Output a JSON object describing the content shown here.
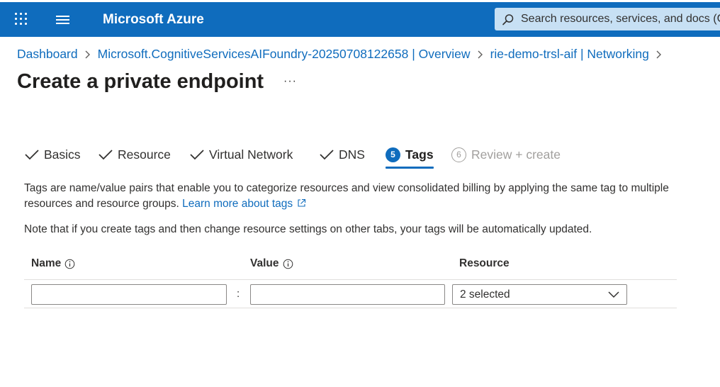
{
  "header": {
    "brand": "Microsoft Azure",
    "search_placeholder": "Search resources, services, and docs (G+/)",
    "bar_color": "#0f6cbd"
  },
  "breadcrumb": [
    {
      "label": "Dashboard"
    },
    {
      "label": "Microsoft.CognitiveServicesAIFoundry-20250708122658 | Overview"
    },
    {
      "label": "rie-demo-trsl-aif | Networking"
    }
  ],
  "page": {
    "title": "Create a private endpoint",
    "more_label": "···"
  },
  "tabs": [
    {
      "label": "Basics",
      "state": "completed"
    },
    {
      "label": "Resource",
      "state": "completed"
    },
    {
      "label": "Virtual Network",
      "state": "completed"
    },
    {
      "label": "DNS",
      "state": "completed"
    },
    {
      "label": "Tags",
      "number": "5",
      "state": "active"
    },
    {
      "label": "Review + create",
      "number": "6",
      "state": "disabled"
    }
  ],
  "description": {
    "text": "Tags are name/value pairs that enable you to categorize resources and view consolidated billing by applying the same tag to multiple resources and resource groups.",
    "link": "Learn more about tags",
    "note": "Note that if you create tags and then change resource settings on other tabs, your tags will be automatically updated."
  },
  "tags_table": {
    "columns": {
      "name": "Name",
      "value": "Value",
      "resource": "Resource"
    },
    "row": {
      "name_value": "",
      "separator": ":",
      "value_value": "",
      "resource_selected": "2 selected"
    }
  }
}
